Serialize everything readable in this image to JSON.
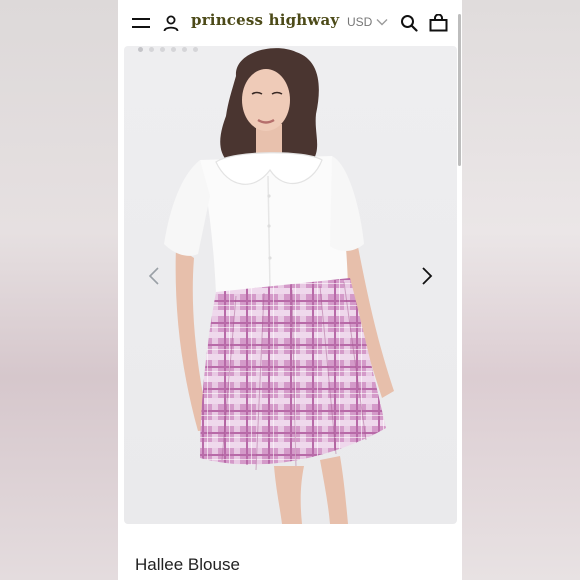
{
  "header": {
    "brand": "princess highway",
    "currency": "USD",
    "icons": {
      "menu": "hamburger-menu-icon",
      "account": "user-icon",
      "currency_caret": "chevron-down-icon",
      "search": "search-icon",
      "cart": "shopping-bag-icon"
    }
  },
  "gallery": {
    "image": "product-photo",
    "slide_count": 6,
    "active_slide": 1,
    "prev_icon": "chevron-left-icon",
    "next_icon": "chevron-right-icon"
  },
  "product": {
    "title": "Hallee Blouse"
  },
  "colors": {
    "brand": "#4c4a18",
    "skirt_pink": "#cf8fc4",
    "blouse_white": "#fafafa",
    "background": "#ffffff"
  }
}
